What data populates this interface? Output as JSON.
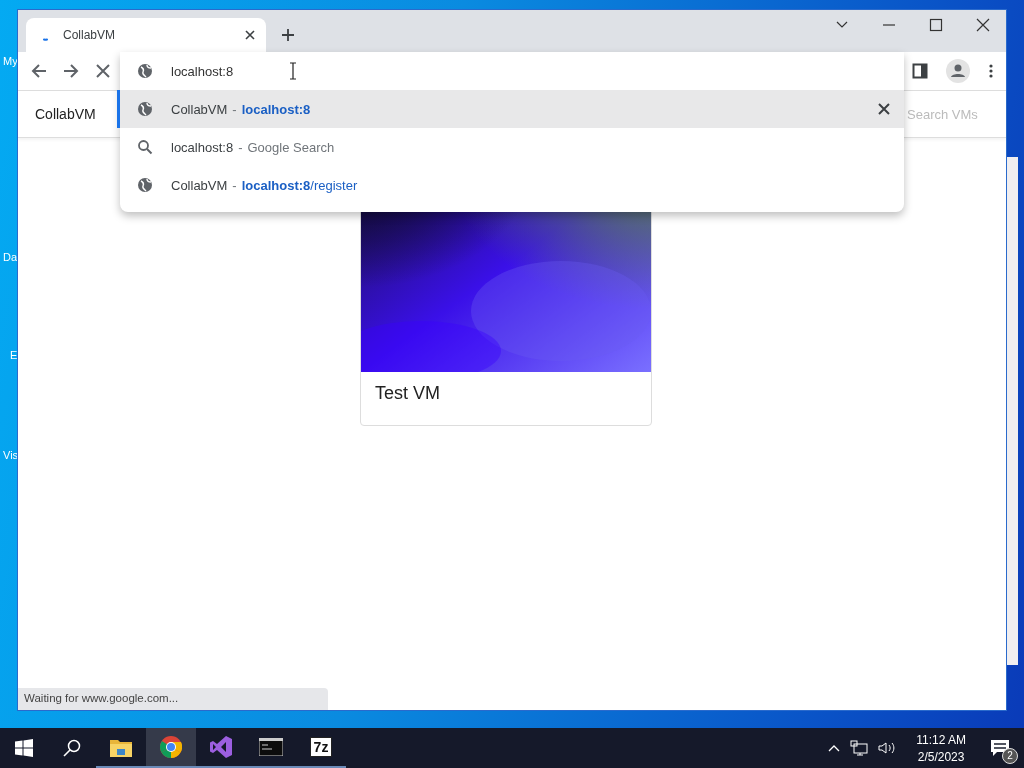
{
  "desktop_icons": [
    {
      "label": "My"
    },
    {
      "label": "Da"
    },
    {
      "label": "E"
    },
    {
      "label": "Vis"
    }
  ],
  "browser": {
    "tabs": [
      {
        "title": "CollabVM",
        "selected": true,
        "loading": true
      }
    ],
    "omnibox": {
      "value": "localhost:8"
    },
    "suggestions": [
      {
        "kind": "history",
        "title": "CollabVM",
        "separator": "-",
        "detail": "**localhost:8**",
        "selected": true
      },
      {
        "kind": "search",
        "title": "localhost:8",
        "separator": "-",
        "detail": "Google Search",
        "selected": false
      },
      {
        "kind": "history",
        "title": "CollabVM",
        "separator": "-",
        "detail": "**localhost:8**/register",
        "selected": false
      }
    ],
    "page": {
      "brand": "CollabVM",
      "search": {
        "placeholder": "Search VMs"
      },
      "vms": [
        {
          "title": "Test VM"
        }
      ]
    },
    "status_bar": "Waiting for www.google.com..."
  },
  "taskbar": {
    "apps": [
      {
        "selected": false
      },
      {
        "selected": true
      },
      {
        "selected": false
      },
      {
        "selected": false
      },
      {
        "selected": false,
        "label": "7z"
      }
    ],
    "clock": {
      "time": "11:12 AM",
      "date": "2/5/2023"
    },
    "notifications": "2"
  }
}
